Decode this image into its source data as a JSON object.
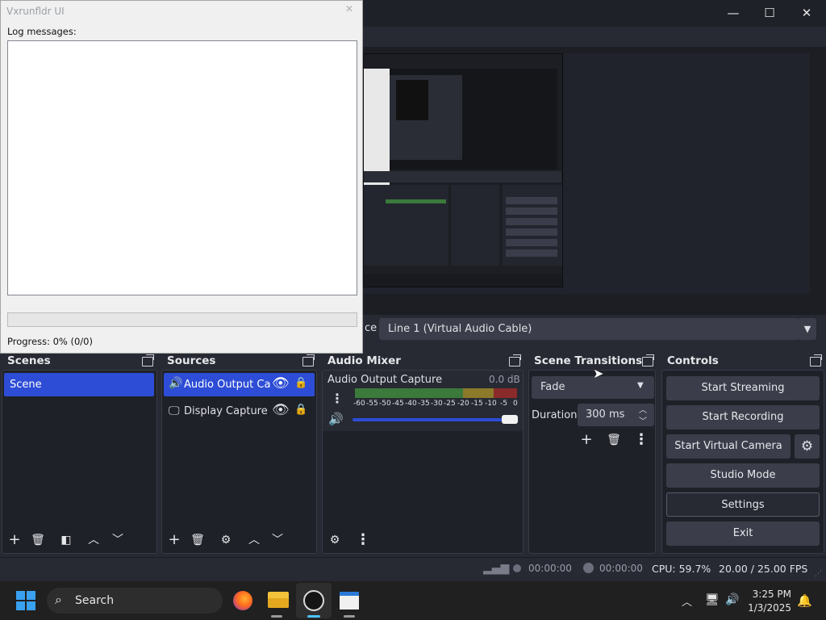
{
  "log_dialog": {
    "title": "Vxrunfldr UI",
    "close_glyph": "✕",
    "label": "Log messages:",
    "progress_fraction": 0,
    "progress_text": "Progress: 0% (0/0)"
  },
  "window": {
    "minimize": "—",
    "maximize": "☐",
    "close": "✕"
  },
  "source_bar": {
    "label": "ce",
    "selected": "Line 1 (Virtual Audio Cable)"
  },
  "scenes": {
    "title": "Scenes",
    "items": [
      "Scene"
    ]
  },
  "sources": {
    "title": "Sources",
    "items": [
      {
        "label": "Audio Output Capture",
        "icon": "speaker-icon"
      },
      {
        "label": "Display Capture",
        "icon": "monitor-icon"
      }
    ]
  },
  "audio_mixer": {
    "title": "Audio Mixer",
    "channel_name": "Audio Output Capture",
    "channel_level": "0.0 dB",
    "scale": [
      "-60",
      "-55",
      "-50",
      "-45",
      "-40",
      "-35",
      "-30",
      "-25",
      "-20",
      "-15",
      "-10",
      "-5",
      "0"
    ]
  },
  "transitions": {
    "title": "Scene Transitions",
    "selected": "Fade",
    "duration_label": "Duration",
    "duration_value": "300 ms"
  },
  "controls": {
    "title": "Controls",
    "start_streaming": "Start Streaming",
    "start_recording": "Start Recording",
    "start_virtual_camera": "Start Virtual Camera",
    "studio_mode": "Studio Mode",
    "settings": "Settings",
    "exit": "Exit"
  },
  "status": {
    "stream_time": "00:00:00",
    "record_time": "00:00:00",
    "cpu": "CPU: 59.7%",
    "fps": "20.00 / 25.00 FPS"
  },
  "taskbar": {
    "search_placeholder": "Search",
    "time": "3:25 PM",
    "date": "1/3/2025"
  },
  "colors": {
    "accent": "#2d4dd6",
    "meter_green": "#3b7a3b",
    "meter_yellow": "#8a7a2a",
    "meter_red": "#8a2a2a"
  }
}
